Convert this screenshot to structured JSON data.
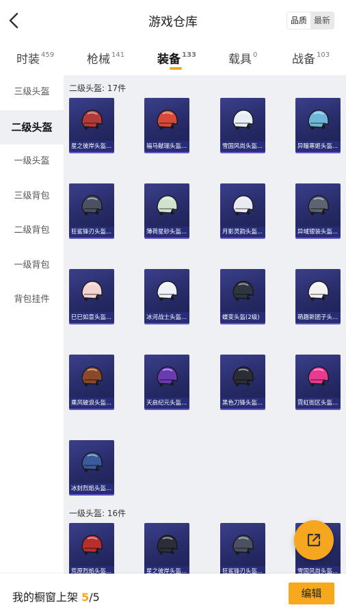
{
  "header": {
    "title": "游戏仓库",
    "sort_options": [
      "品质",
      "最新"
    ],
    "back_icon": "back-chevron-icon"
  },
  "tabs": [
    {
      "label": "时装",
      "count": "459"
    },
    {
      "label": "枪械",
      "count": "141"
    },
    {
      "label": "装备",
      "count": "133"
    },
    {
      "label": "载具",
      "count": "0"
    },
    {
      "label": "战备",
      "count": "103"
    }
  ],
  "active_tab": "装备",
  "sidebar": {
    "items": [
      "三级头盔",
      "二级头盔",
      "一级头盔",
      "三级背包",
      "二级背包",
      "一级背包",
      "背包挂件"
    ],
    "active": "二级头盔"
  },
  "sections": [
    {
      "title": "二级头盔: 17件",
      "items": [
        {
          "name": "星之彼岸头盔...",
          "color": "#b23a3a"
        },
        {
          "name": "福马献瑞头盔...",
          "color": "#d8493a"
        },
        {
          "name": "雪国风尚头盔...",
          "color": "#e8eef5"
        },
        {
          "name": "异瞳寒姬头盔...",
          "color": "#6fb7d8"
        },
        {
          "name": "狂鲨锋刃头盔...",
          "color": "#4b5160"
        },
        {
          "name": "薄荷星砂头盔...",
          "color": "#cfe3cf"
        },
        {
          "name": "月影灵韵头盔...",
          "color": "#e9eaf2"
        },
        {
          "name": "异域银装头盔...",
          "color": "#5b6470"
        },
        {
          "name": "巳巳如意头盔...",
          "color": "#f1d3cf"
        },
        {
          "name": "冰河战士头盔...",
          "color": "#eef2f7"
        },
        {
          "name": "蝶变头盔(2级)",
          "color": "#2f3640"
        },
        {
          "name": "萌趣新团子头...",
          "color": "#f2f2f2"
        },
        {
          "name": "乘风破浪头盔...",
          "color": "#8a4a2a"
        },
        {
          "name": "天启纪元头盔...",
          "color": "#6a3bb0"
        },
        {
          "name": "黑色刀锋头盔...",
          "color": "#2a2d33"
        },
        {
          "name": "霓虹街区头盔...",
          "color": "#e83a8f"
        },
        {
          "name": "冰封烈焰头盔...",
          "color": "#3a5a9a"
        }
      ]
    },
    {
      "title": "一级头盔: 16件",
      "items": [
        {
          "name": "荒原烈焰头盔...",
          "color": "#b82e2e"
        },
        {
          "name": "星之彼岸头盔...",
          "color": "#2d2d3a"
        },
        {
          "name": "狂鲨锋刃头盔...",
          "color": "#4b5160"
        },
        {
          "name": "雪国风尚头盔...",
          "color": "#e8eef5"
        }
      ]
    }
  ],
  "footer": {
    "label": "我的橱窗上架",
    "current": "5",
    "separator": "/",
    "total": "5",
    "edit_label": "编辑"
  },
  "colors": {
    "accent": "#f5a623",
    "card_bg": "#262a66",
    "content_bg": "#eef0f3"
  },
  "fab_icon": "share-external-icon"
}
